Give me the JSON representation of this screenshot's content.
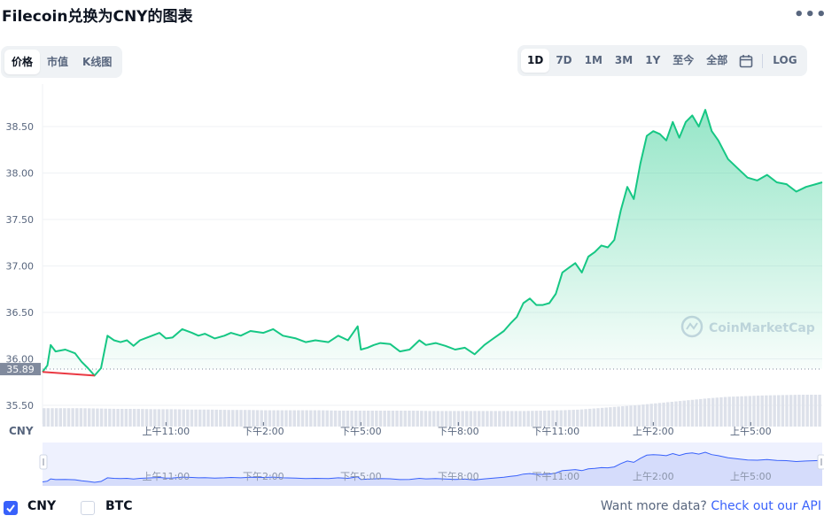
{
  "header": {
    "title": "Filecoin兑换为CNY的图表",
    "more_label": "•••"
  },
  "left_tabs": [
    {
      "label": "价格"
    },
    {
      "label": "市值"
    },
    {
      "label": "K线图"
    }
  ],
  "right_tabs": [
    {
      "label": "1D"
    },
    {
      "label": "7D"
    },
    {
      "label": "1M"
    },
    {
      "label": "3M"
    },
    {
      "label": "1Y"
    },
    {
      "label": "至今"
    },
    {
      "label": "全部"
    }
  ],
  "log_label": "LOG",
  "active_left_tab": "价格",
  "active_right_tab": "1D",
  "icons": {
    "calendar": "calendar-icon",
    "more": "more-dots-icon",
    "checkmark": "check-icon",
    "watermark": "coinmarketcap-logo-icon"
  },
  "colors": {
    "accent": "#3861fb",
    "line": "#16c784",
    "baseline_label_bg": "#808a9d"
  },
  "chart_data": {
    "type": "area",
    "currency_axis_label": "CNY",
    "watermark": "CoinMarketCap",
    "y_ticks": [
      "38.50",
      "38.00",
      "37.50",
      "37.00",
      "36.50",
      "36.00",
      "35.50"
    ],
    "ylim": [
      35.3,
      38.8
    ],
    "x_ticks": [
      "上午11:00",
      "下午2:00",
      "下午5:00",
      "下午8:00",
      "下午11:00",
      "上午2:00",
      "上午5:00"
    ],
    "x_tick_hours": [
      11,
      14,
      17,
      20,
      23,
      26,
      29
    ],
    "x_range_hours": [
      7.2,
      31.2
    ],
    "baseline_value": 35.89,
    "baseline_label": "35.89",
    "series": [
      {
        "name": "CNY",
        "x": [
          7.2,
          7.35,
          7.45,
          7.6,
          7.9,
          8.2,
          8.4,
          8.6,
          8.8,
          9.0,
          9.2,
          9.4,
          9.6,
          9.8,
          10.0,
          10.2,
          10.5,
          10.8,
          11.0,
          11.2,
          11.5,
          11.8,
          12.0,
          12.2,
          12.5,
          12.8,
          13.0,
          13.3,
          13.6,
          14.0,
          14.3,
          14.6,
          15.0,
          15.3,
          15.6,
          16.0,
          16.3,
          16.6,
          16.9,
          17.0,
          17.2,
          17.4,
          17.6,
          17.9,
          18.2,
          18.5,
          18.8,
          19.0,
          19.3,
          19.6,
          19.9,
          20.2,
          20.5,
          20.8,
          21.0,
          21.2,
          21.4,
          21.6,
          21.8,
          22.0,
          22.2,
          22.4,
          22.6,
          22.8,
          23.0,
          23.2,
          23.4,
          23.6,
          23.8,
          24.0,
          24.2,
          24.4,
          24.6,
          24.8,
          25.0,
          25.2,
          25.4,
          25.6,
          25.8,
          26.0,
          26.2,
          26.4,
          26.6,
          26.8,
          27.0,
          27.2,
          27.4,
          27.6,
          27.8,
          28.0,
          28.3,
          28.6,
          28.9,
          29.2,
          29.5,
          29.8,
          30.1,
          30.4,
          30.7,
          31.0,
          31.2
        ],
        "values": [
          35.86,
          35.93,
          36.15,
          36.08,
          36.1,
          36.06,
          35.97,
          35.9,
          35.82,
          35.9,
          36.25,
          36.2,
          36.18,
          36.2,
          36.14,
          36.2,
          36.24,
          36.28,
          36.22,
          36.23,
          36.32,
          36.28,
          36.25,
          36.27,
          36.22,
          36.25,
          36.28,
          36.25,
          36.3,
          36.28,
          36.32,
          36.25,
          36.22,
          36.18,
          36.2,
          36.18,
          36.25,
          36.2,
          36.35,
          36.1,
          36.12,
          36.15,
          36.17,
          36.16,
          36.08,
          36.1,
          36.2,
          36.15,
          36.17,
          36.14,
          36.1,
          36.12,
          36.05,
          36.15,
          36.2,
          36.25,
          36.3,
          36.38,
          36.45,
          36.6,
          36.65,
          36.58,
          36.58,
          36.6,
          36.7,
          36.93,
          36.98,
          37.03,
          36.93,
          37.1,
          37.15,
          37.22,
          37.2,
          37.28,
          37.6,
          37.85,
          37.72,
          38.1,
          38.4,
          38.45,
          38.42,
          38.35,
          38.55,
          38.38,
          38.55,
          38.62,
          38.5,
          38.68,
          38.45,
          38.35,
          38.15,
          38.05,
          37.95,
          37.92,
          37.98,
          37.9,
          37.88,
          37.8,
          37.85,
          37.88,
          37.9
        ]
      }
    ],
    "volume_relative": [
      0.52,
      0.52,
      0.52,
      0.51,
      0.5,
      0.5,
      0.49,
      0.49,
      0.48,
      0.48,
      0.47,
      0.47,
      0.46,
      0.46,
      0.46,
      0.46,
      0.45,
      0.45,
      0.45,
      0.45,
      0.45,
      0.44,
      0.44,
      0.44,
      0.44,
      0.44,
      0.44,
      0.45,
      0.46,
      0.48,
      0.52,
      0.56,
      0.6,
      0.65,
      0.7,
      0.75,
      0.8,
      0.84,
      0.86,
      0.88,
      0.89,
      0.9,
      0.9
    ],
    "navigator": {
      "x_ticks": [
        "上午11:00",
        "下午2:00",
        "下午5:00",
        "下午8:00",
        "下午11:00",
        "上午2:00",
        "上午5:00"
      ]
    },
    "legend": "bottom-left",
    "grid": true
  },
  "footer": {
    "options": [
      {
        "label": "CNY",
        "checked": true
      },
      {
        "label": "BTC",
        "checked": false
      }
    ],
    "more_text": "Want more data?",
    "api_link": "Check out our API"
  }
}
